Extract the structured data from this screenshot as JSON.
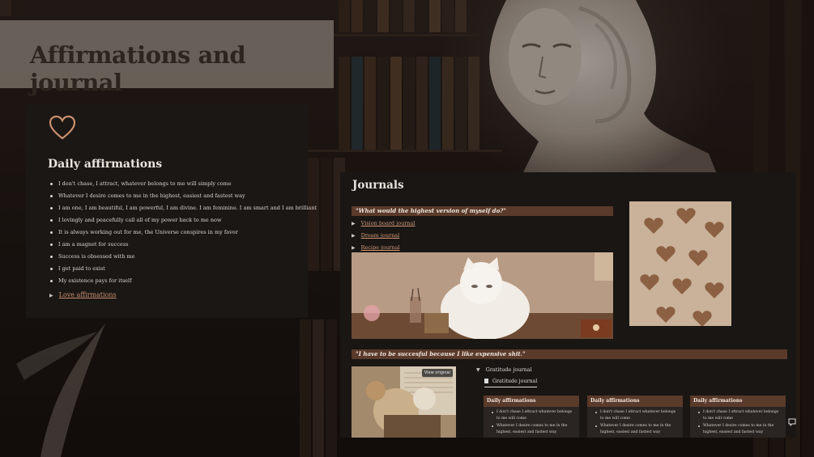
{
  "page": {
    "title": "Affirmations and journal"
  },
  "affirmations": {
    "icon": "heart-icon",
    "heading": "Daily affirmations",
    "items": [
      "I don't chase, I attract, whatever belongs to me will simply come",
      "Whatever I desire comes to me in the highest, easiest and fastest way",
      "I am one, I am beautiful, I am powerful, I am divine. I am feminine. I am smart and I am brilliant",
      "I lovingly and peacefully call all of my power back to me now",
      "It is always working out for me, the Universe conspires in my favor",
      "I am a magnet for success",
      "Success is obsessed with me",
      "I get paid to exist",
      "My existence pays for itself"
    ],
    "toggle_label": "Love affirmations"
  },
  "journals": {
    "heading": "Journals",
    "quote1": "\"What would the highest version of myself do?\"",
    "links": [
      "Vision board journal",
      "Dream journal",
      "Recipe journal"
    ],
    "quote2": "\"I have to be succesful because I like expensive shit.\"",
    "view_original": "View original",
    "gratitude_toggle": "Gratitude journal",
    "gratitude_tab": "Gratitude journal",
    "cards": [
      {
        "title": "Daily affirmations",
        "items": [
          "I don't chase I attract whatever belongs to me will come",
          "Whatever I desire comes to me in the highest, easiest and fastest way"
        ]
      },
      {
        "title": "Daily affirmations",
        "items": [
          "I don't chase I attract whatever belongs to me will come",
          "Whatever I desire comes to me in the highest, easiest and fastest way"
        ]
      },
      {
        "title": "Daily affirmations",
        "items": [
          "I don't chase I attract whatever belongs to me will come",
          "Whatever I desire comes to me in the highest, easiest and fastest way"
        ]
      }
    ]
  },
  "colors": {
    "accent": "#c98f6e",
    "quote_bar": "#5a3a2a",
    "card_bg": "#1b1715"
  }
}
